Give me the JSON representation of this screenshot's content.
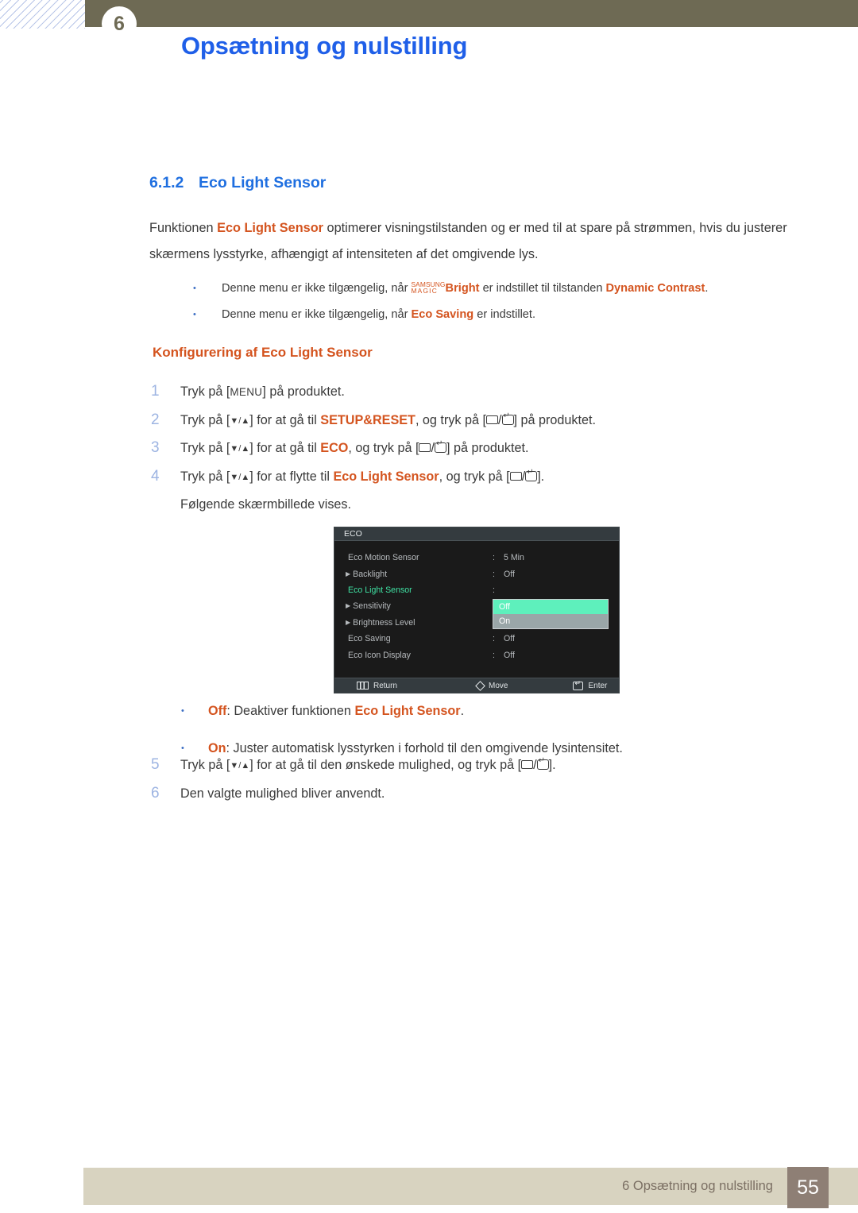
{
  "header": {
    "chapter_number": "6",
    "title": "Opsætning og nulstilling"
  },
  "section": {
    "number": "6.1.2",
    "title": "Eco Light Sensor"
  },
  "intro": {
    "part1": "Funktionen ",
    "keyword1": "Eco Light Sensor",
    "part2": " optimerer visningstilstanden og er med til at spare på strømmen, hvis du justerer skærmens lysstyrke, afhængigt af intensiteten af det omgivende lys."
  },
  "notes": [
    {
      "bullet": "•",
      "pre": "Denne menu er ikke tilgængelig, når ",
      "magic_line1": "SAMSUNG",
      "magic_line2": "MAGIC",
      "magic_word": "Bright",
      "mid": " er indstillet til tilstanden ",
      "keyword": "Dynamic Contrast",
      "post": "."
    },
    {
      "bullet": "•",
      "pre": "Denne menu er ikke tilgængelig, når ",
      "keyword": "Eco Saving",
      "post": " er indstillet."
    }
  ],
  "sub_heading": "Konfigurering af Eco Light Sensor",
  "steps": [
    {
      "num": "1",
      "pre": "Tryk på [",
      "key": "MENU",
      "post": "] på produktet."
    },
    {
      "num": "2",
      "pre": "Tryk på [",
      "arrows": "▼/▲",
      "mid1": "] for at gå til ",
      "keyword": "SETUP&RESET",
      "mid2": ", og tryk på [",
      "sep": "/",
      "post": "] på produktet."
    },
    {
      "num": "3",
      "pre": "Tryk på [",
      "arrows": "▼/▲",
      "mid1": "] for at gå til ",
      "keyword": "ECO",
      "mid2": ", og tryk på [",
      "sep": "/",
      "post": "] på produktet."
    },
    {
      "num": "4",
      "pre": "Tryk på [",
      "arrows": "▼/▲",
      "mid1": "] for at flytte til ",
      "keyword": "Eco Light Sensor",
      "mid2": ", og tryk på [",
      "sep": "/",
      "post": "].",
      "sub_line": "Følgende skærmbillede vises."
    }
  ],
  "steps_after": [
    {
      "num": "5",
      "pre": "Tryk på [",
      "arrows": "▼/▲",
      "mid1": "] for at gå til den ønskede mulighed, og tryk på [",
      "sep": "/",
      "post": "]."
    },
    {
      "num": "6",
      "pre": "Den valgte mulighed bliver anvendt.",
      "post": ""
    }
  ],
  "osd": {
    "title": "ECO",
    "rows": [
      {
        "label": "Eco Motion Sensor",
        "arrow": "",
        "colon": ":",
        "value": "5 Min",
        "active": false
      },
      {
        "label": "Backlight",
        "arrow": "▶",
        "colon": ":",
        "value": "Off",
        "active": false
      },
      {
        "label": "Eco Light Sensor",
        "arrow": "",
        "colon": ":",
        "value": "",
        "active": true
      },
      {
        "label": "Sensitivity",
        "arrow": "▶",
        "colon": ":",
        "value": "",
        "active": false
      },
      {
        "label": "Brightness Level",
        "arrow": "▶",
        "colon": "",
        "value": "",
        "active": false
      },
      {
        "label": "Eco Saving",
        "arrow": "",
        "colon": ":",
        "value": "Off",
        "active": false
      },
      {
        "label": "Eco Icon Display",
        "arrow": "",
        "colon": ":",
        "value": "Off",
        "active": false
      }
    ],
    "dropdown": {
      "selected": "Off",
      "other": "On"
    },
    "footer": {
      "return": "Return",
      "move": "Move",
      "enter": "Enter"
    },
    "colors": {
      "active_label": "#3fe0a2",
      "selected_option_bg": "#5ef0bc",
      "unselected_option_bg": "#9aa6a8",
      "panel_bg": "#1a1a1a",
      "title_bg": "#343b3f"
    }
  },
  "options": [
    {
      "bullet": "•",
      "keyword": "Off",
      "mid": ": Deaktiver funktionen ",
      "keyword2": "Eco Light Sensor",
      "post": "."
    },
    {
      "bullet": "•",
      "keyword": "On",
      "mid": ": Juster automatisk lysstyrken i forhold til den omgivende lysintensitet.",
      "keyword2": "",
      "post": ""
    }
  ],
  "footer": {
    "text": "6 Opsætning og nulstilling",
    "page": "55"
  },
  "colors": {
    "header_band": "#6e6a54",
    "header_title": "#1f5fe8",
    "section_heading": "#1f6fe0",
    "orange_keyword": "#d4541f",
    "step_number": "#9db4e2",
    "footer_band": "#d8d3c0",
    "footer_page_box": "#8e7f75"
  }
}
